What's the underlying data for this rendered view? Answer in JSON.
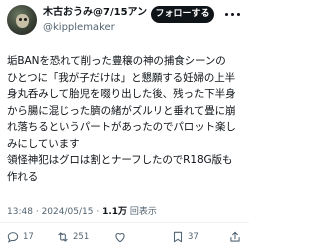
{
  "author": {
    "display_name": "木古おうみ@7/15アンソロ…",
    "handle": "@kipplemaker",
    "follow_label": "フォローする"
  },
  "tweet": {
    "lines": [
      "垢BANを恐れて削った豊穣の神の捕食シーンの",
      "ひとつに「我が子だけは」と懇願する妊婦の上半",
      "身丸呑みして胎児を啜り出した後、残った下半身",
      "から腸に混じった臍の緒がズルリと垂れて畳に崩",
      "れ落ちるというパートがあったのでパロット楽し",
      "みにしています",
      "領怪神犯はグロは割とナーフしたのでR18G版も",
      "作れる"
    ]
  },
  "meta": {
    "time": "13:48",
    "date": "2024/05/15",
    "separator": "·",
    "views_count": "1.1万",
    "views_label": "回表示"
  },
  "actions": {
    "replies": "17",
    "retweets": "251",
    "likes": "",
    "bookmarks": "37"
  }
}
